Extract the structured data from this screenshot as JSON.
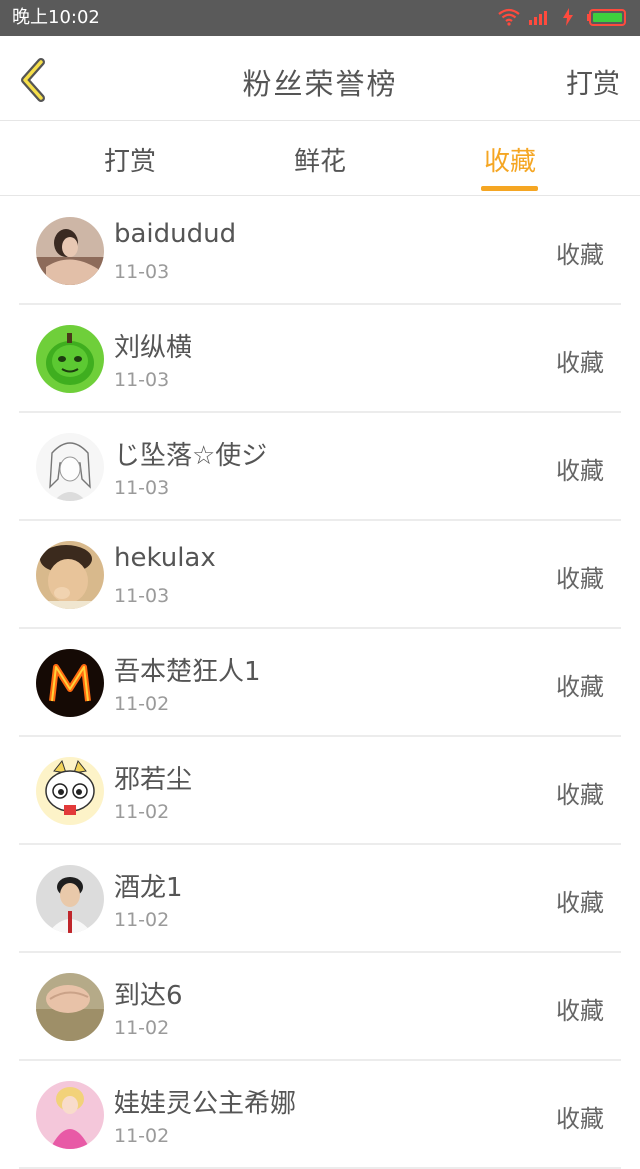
{
  "status_bar": {
    "time": "晚上10:02"
  },
  "header": {
    "title": "粉丝荣誉榜",
    "right_link": "打赏",
    "back_icon": "chevron-left-icon"
  },
  "tabs": [
    {
      "label": "打赏",
      "active": false
    },
    {
      "label": "鲜花",
      "active": false
    },
    {
      "label": "收藏",
      "active": true
    }
  ],
  "colors": {
    "accent": "#f5a623",
    "text": "#555555",
    "secondary_text": "#9a9a9a",
    "status_bar": "#5a5a5a"
  },
  "rows": [
    {
      "name": "baidudud",
      "date": "11-03",
      "action": "收藏"
    },
    {
      "name": "刘纵横",
      "date": "11-03",
      "action": "收藏"
    },
    {
      "name": "じ坠落☆使ジ",
      "date": "11-03",
      "action": "收藏"
    },
    {
      "name": "hekulax",
      "date": "11-03",
      "action": "收藏"
    },
    {
      "name": "吾本楚狂人1",
      "date": "11-02",
      "action": "收藏"
    },
    {
      "name": "邪若尘",
      "date": "11-02",
      "action": "收藏"
    },
    {
      "name": "酒龙1",
      "date": "11-02",
      "action": "收藏"
    },
    {
      "name": "到达6",
      "date": "11-02",
      "action": "收藏"
    },
    {
      "name": "娃娃灵公主希娜",
      "date": "11-02",
      "action": "收藏"
    }
  ]
}
